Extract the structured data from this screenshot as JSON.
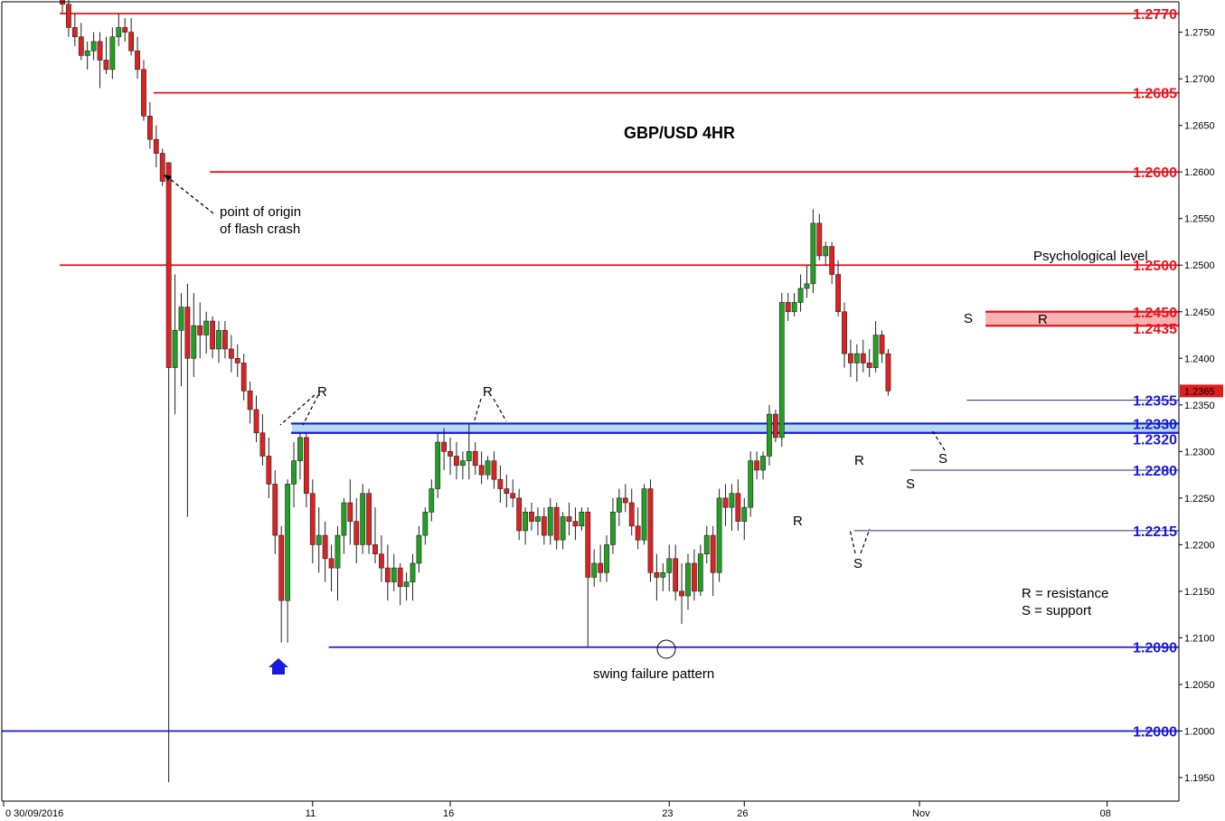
{
  "chart_data": {
    "type": "candlestick",
    "title": "GBP/USD 4HR",
    "ylim": [
      1.194,
      1.2785
    ],
    "yticks": [
      "1.2750",
      "1.2700",
      "1.2650",
      "1.2600",
      "1.2550",
      "1.2500",
      "1.2450",
      "1.2400",
      "1.2350",
      "1.2300",
      "1.2250",
      "1.2200",
      "1.2150",
      "1.2100",
      "1.2050",
      "1.2000",
      "1.1950"
    ],
    "yticks_values": [
      1.275,
      1.27,
      1.265,
      1.26,
      1.255,
      1.25,
      1.245,
      1.24,
      1.235,
      1.23,
      1.225,
      1.22,
      1.215,
      1.21,
      1.205,
      1.2,
      1.195
    ],
    "xticks": [
      "0 30/09/2016",
      "11",
      "16",
      "23",
      "26",
      "Nov",
      "08"
    ],
    "xticks_bar_index": [
      0,
      40,
      62,
      97,
      109,
      137,
      167
    ],
    "last_price_label": "1.2365",
    "last_price": 1.2365,
    "colors": {
      "up": "#22a022",
      "down": "#dd2222",
      "resistance": "#e8141e",
      "support": "#1a1adc",
      "zone_red": "#f5a0a0",
      "zone_blue": "#a8d4f4"
    },
    "levels": [
      {
        "label": "1.2770",
        "value": 1.277,
        "kind": "resistance",
        "from_bar": 0
      },
      {
        "label": "1.2685",
        "value": 1.2685,
        "kind": "resistance",
        "from_bar": 15
      },
      {
        "label": "1.2600",
        "value": 1.26,
        "kind": "resistance",
        "from_bar": 24
      },
      {
        "label": "1.2500",
        "value": 1.25,
        "kind": "resistance",
        "from_bar": 0
      },
      {
        "label": "1.2450",
        "value": 1.245,
        "kind": "resistance-zone-top",
        "from_bar": 148
      },
      {
        "label": "1.2435",
        "value": 1.2435,
        "kind": "resistance-zone-bottom",
        "from_bar": 148
      },
      {
        "label": "1.2355",
        "value": 1.2355,
        "kind": "support-thin",
        "from_bar": 145
      },
      {
        "label": "1.2330",
        "value": 1.233,
        "kind": "support-zone-top",
        "from_bar": 37
      },
      {
        "label": "1.2320",
        "value": 1.232,
        "kind": "support-zone-bottom",
        "from_bar": 37
      },
      {
        "label": "1.2280",
        "value": 1.228,
        "kind": "support-thin",
        "from_bar": 136
      },
      {
        "label": "1.2215",
        "value": 1.2215,
        "kind": "support-thin",
        "from_bar": 127
      },
      {
        "label": "1.2090",
        "value": 1.209,
        "kind": "support",
        "from_bar": 43
      },
      {
        "label": "1.2000",
        "value": 1.2,
        "kind": "support",
        "from_bar": -1
      }
    ],
    "candles": [
      [
        1.2795,
        1.2805,
        1.277,
        1.278
      ],
      [
        1.278,
        1.279,
        1.2745,
        1.2755
      ],
      [
        1.2755,
        1.277,
        1.2735,
        1.2745
      ],
      [
        1.2745,
        1.276,
        1.272,
        1.2725
      ],
      [
        1.2725,
        1.274,
        1.271,
        1.273
      ],
      [
        1.273,
        1.275,
        1.272,
        1.274
      ],
      [
        1.274,
        1.275,
        1.269,
        1.272
      ],
      [
        1.272,
        1.2745,
        1.2705,
        1.271
      ],
      [
        1.271,
        1.2755,
        1.27,
        1.2745
      ],
      [
        1.2745,
        1.277,
        1.2735,
        1.2755
      ],
      [
        1.2755,
        1.2765,
        1.274,
        1.275
      ],
      [
        1.275,
        1.2765,
        1.2725,
        1.273
      ],
      [
        1.273,
        1.2745,
        1.27,
        1.271
      ],
      [
        1.271,
        1.272,
        1.2655,
        1.266
      ],
      [
        1.266,
        1.2675,
        1.2625,
        1.2635
      ],
      [
        1.2635,
        1.265,
        1.2605,
        1.262
      ],
      [
        1.262,
        1.2625,
        1.2585,
        1.259
      ],
      [
        1.261,
        1.261,
        1.1945,
        1.239
      ],
      [
        1.239,
        1.249,
        1.234,
        1.243
      ],
      [
        1.243,
        1.247,
        1.237,
        1.2455
      ],
      [
        1.2455,
        1.248,
        1.223,
        1.24
      ],
      [
        1.24,
        1.247,
        1.238,
        1.2435
      ],
      [
        1.2435,
        1.246,
        1.24,
        1.2425
      ],
      [
        1.2425,
        1.245,
        1.2405,
        1.244
      ],
      [
        1.244,
        1.2445,
        1.24,
        1.241
      ],
      [
        1.241,
        1.244,
        1.2395,
        1.243
      ],
      [
        1.243,
        1.244,
        1.24,
        1.241
      ],
      [
        1.241,
        1.2425,
        1.2385,
        1.24
      ],
      [
        1.24,
        1.2415,
        1.238,
        1.2395
      ],
      [
        1.2395,
        1.2405,
        1.2355,
        1.2365
      ],
      [
        1.2365,
        1.2375,
        1.233,
        1.2345
      ],
      [
        1.2345,
        1.236,
        1.231,
        1.232
      ],
      [
        1.232,
        1.234,
        1.2285,
        1.2295
      ],
      [
        1.2295,
        1.2315,
        1.225,
        1.2265
      ],
      [
        1.2265,
        1.228,
        1.219,
        1.221
      ],
      [
        1.221,
        1.222,
        1.2095,
        1.214
      ],
      [
        1.214,
        1.227,
        1.2095,
        1.2265
      ],
      [
        1.2265,
        1.231,
        1.224,
        1.229
      ],
      [
        1.229,
        1.232,
        1.227,
        1.2315
      ],
      [
        1.2315,
        1.232,
        1.224,
        1.2255
      ],
      [
        1.2255,
        1.227,
        1.218,
        1.22
      ],
      [
        1.22,
        1.224,
        1.217,
        1.221
      ],
      [
        1.221,
        1.2225,
        1.216,
        1.2185
      ],
      [
        1.2185,
        1.22,
        1.215,
        1.2175
      ],
      [
        1.2175,
        1.222,
        1.214,
        1.221
      ],
      [
        1.221,
        1.225,
        1.219,
        1.2245
      ],
      [
        1.2245,
        1.227,
        1.22,
        1.2225
      ],
      [
        1.2225,
        1.225,
        1.218,
        1.22
      ],
      [
        1.22,
        1.2265,
        1.219,
        1.2255
      ],
      [
        1.2255,
        1.226,
        1.219,
        1.22
      ],
      [
        1.22,
        1.224,
        1.218,
        1.219
      ],
      [
        1.219,
        1.221,
        1.216,
        1.2175
      ],
      [
        1.2175,
        1.22,
        1.214,
        1.216
      ],
      [
        1.216,
        1.219,
        1.215,
        1.2175
      ],
      [
        1.2175,
        1.218,
        1.2135,
        1.2155
      ],
      [
        1.2155,
        1.217,
        1.214,
        1.216
      ],
      [
        1.216,
        1.219,
        1.214,
        1.218
      ],
      [
        1.218,
        1.222,
        1.217,
        1.221
      ],
      [
        1.221,
        1.224,
        1.22,
        1.2235
      ],
      [
        1.2235,
        1.227,
        1.2225,
        1.226
      ],
      [
        1.226,
        1.232,
        1.225,
        1.231
      ],
      [
        1.231,
        1.2325,
        1.228,
        1.23
      ],
      [
        1.23,
        1.2315,
        1.2275,
        1.2295
      ],
      [
        1.2295,
        1.231,
        1.227,
        1.2285
      ],
      [
        1.2285,
        1.23,
        1.227,
        1.229
      ],
      [
        1.229,
        1.233,
        1.227,
        1.23
      ],
      [
        1.23,
        1.231,
        1.2275,
        1.2285
      ],
      [
        1.2285,
        1.23,
        1.2265,
        1.2275
      ],
      [
        1.2275,
        1.2295,
        1.227,
        1.229
      ],
      [
        1.229,
        1.23,
        1.226,
        1.227
      ],
      [
        1.227,
        1.2285,
        1.2245,
        1.226
      ],
      [
        1.226,
        1.2275,
        1.224,
        1.2255
      ],
      [
        1.2255,
        1.227,
        1.224,
        1.225
      ],
      [
        1.225,
        1.226,
        1.2205,
        1.2215
      ],
      [
        1.2215,
        1.224,
        1.22,
        1.2235
      ],
      [
        1.2235,
        1.2245,
        1.2215,
        1.2225
      ],
      [
        1.2225,
        1.224,
        1.221,
        1.223
      ],
      [
        1.223,
        1.224,
        1.22,
        1.221
      ],
      [
        1.221,
        1.225,
        1.22,
        1.224
      ],
      [
        1.224,
        1.2245,
        1.2195,
        1.2205
      ],
      [
        1.2205,
        1.2235,
        1.2195,
        1.223
      ],
      [
        1.223,
        1.2245,
        1.221,
        1.2225
      ],
      [
        1.2225,
        1.224,
        1.2205,
        1.222
      ],
      [
        1.222,
        1.224,
        1.2215,
        1.2235
      ],
      [
        1.2235,
        1.224,
        1.209,
        1.2165
      ],
      [
        1.2165,
        1.2195,
        1.2155,
        1.218
      ],
      [
        1.218,
        1.22,
        1.216,
        1.217
      ],
      [
        1.217,
        1.221,
        1.216,
        1.22
      ],
      [
        1.22,
        1.225,
        1.219,
        1.2235
      ],
      [
        1.2235,
        1.226,
        1.222,
        1.225
      ],
      [
        1.225,
        1.2265,
        1.2235,
        1.2245
      ],
      [
        1.2245,
        1.226,
        1.221,
        1.222
      ],
      [
        1.222,
        1.224,
        1.2195,
        1.2205
      ],
      [
        1.2205,
        1.2265,
        1.22,
        1.226
      ],
      [
        1.226,
        1.227,
        1.216,
        1.217
      ],
      [
        1.217,
        1.219,
        1.214,
        1.2165
      ],
      [
        1.2165,
        1.218,
        1.215,
        1.217
      ],
      [
        1.217,
        1.22,
        1.215,
        1.2185
      ],
      [
        1.2185,
        1.22,
        1.214,
        1.215
      ],
      [
        1.215,
        1.218,
        1.2115,
        1.2145
      ],
      [
        1.2145,
        1.219,
        1.213,
        1.218
      ],
      [
        1.218,
        1.2195,
        1.214,
        1.215
      ],
      [
        1.215,
        1.22,
        1.2145,
        1.219
      ],
      [
        1.219,
        1.222,
        1.218,
        1.221
      ],
      [
        1.221,
        1.222,
        1.2145,
        1.217
      ],
      [
        1.217,
        1.226,
        1.216,
        1.225
      ],
      [
        1.225,
        1.2265,
        1.222,
        1.224
      ],
      [
        1.224,
        1.2265,
        1.2215,
        1.2255
      ],
      [
        1.2255,
        1.227,
        1.2215,
        1.2225
      ],
      [
        1.2225,
        1.225,
        1.2205,
        1.224
      ],
      [
        1.224,
        1.23,
        1.223,
        1.229
      ],
      [
        1.229,
        1.23,
        1.227,
        1.228
      ],
      [
        1.228,
        1.23,
        1.227,
        1.2295
      ],
      [
        1.2295,
        1.235,
        1.2285,
        1.234
      ],
      [
        1.234,
        1.2345,
        1.231,
        1.2315
      ],
      [
        1.2315,
        1.247,
        1.2305,
        1.246
      ],
      [
        1.246,
        1.247,
        1.244,
        1.245
      ],
      [
        1.245,
        1.247,
        1.2445,
        1.246
      ],
      [
        1.246,
        1.249,
        1.245,
        1.2475
      ],
      [
        1.2475,
        1.25,
        1.2465,
        1.248
      ],
      [
        1.248,
        1.256,
        1.247,
        1.2545
      ],
      [
        1.2545,
        1.2555,
        1.2505,
        1.251
      ],
      [
        1.251,
        1.2525,
        1.25,
        1.252
      ],
      [
        1.252,
        1.2525,
        1.248,
        1.249
      ],
      [
        1.249,
        1.2505,
        1.2445,
        1.245
      ],
      [
        1.245,
        1.246,
        1.239,
        1.2405
      ],
      [
        1.2405,
        1.242,
        1.238,
        1.2395
      ],
      [
        1.2395,
        1.2415,
        1.2375,
        1.2405
      ],
      [
        1.2405,
        1.242,
        1.2385,
        1.2395
      ],
      [
        1.2395,
        1.241,
        1.238,
        1.239
      ],
      [
        1.239,
        1.244,
        1.2385,
        1.2425
      ],
      [
        1.2425,
        1.243,
        1.2395,
        1.2405
      ],
      [
        1.2405,
        1.241,
        1.236,
        1.2365
      ]
    ]
  },
  "annotations": {
    "flash_crash": "point of origin\nof flash crash",
    "swing_failure": "swing failure pattern",
    "psych_level": "Psychological level",
    "legend_r": "R = resistance",
    "legend_s": "S = support",
    "r_label": "R",
    "s_label": "S"
  }
}
